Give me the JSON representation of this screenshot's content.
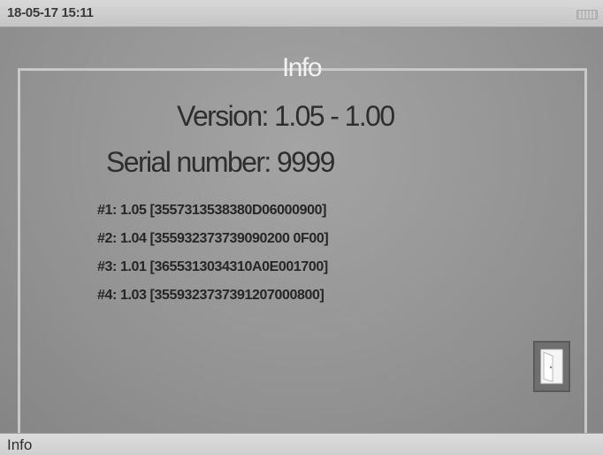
{
  "status_bar": {
    "datetime": "18-05-17 15:11",
    "battery_icon": "battery-icon"
  },
  "screen": {
    "title": "Info",
    "version": "Version: 1.05 - 1.00",
    "serial": "Serial number: 9999",
    "modules": [
      "#1: 1.05 [3557313538380D06000900]",
      "#2: 1.04 [355932373739090200 0F00]",
      "#3: 1.01 [3655313034310A0E001700]",
      "#4: 1.03 [3559323737391207000800]"
    ],
    "exit_icon": "door-exit-icon"
  },
  "bottom_bar": {
    "label": "Info"
  },
  "colors": {
    "background": "#939393",
    "title": "#f2f2f2",
    "text": "#2e2e2e",
    "bar": "#d4d4d4"
  }
}
